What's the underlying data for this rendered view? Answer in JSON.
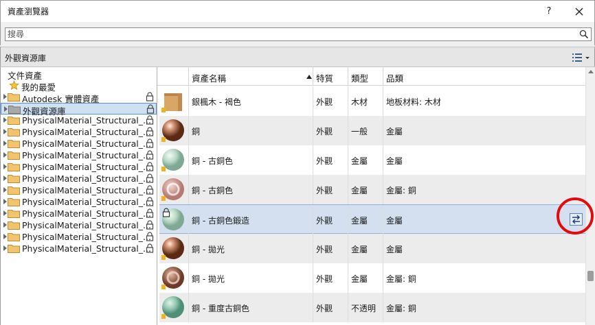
{
  "window": {
    "title": "資產瀏覽器",
    "help_label": "?"
  },
  "search": {
    "placeholder": "搜尋",
    "value": ""
  },
  "library_bar": {
    "title": "外觀資源庫"
  },
  "tree": {
    "items": [
      {
        "label": "文件資產",
        "icon": "none",
        "arrow": false,
        "lock": false
      },
      {
        "label": "我的最愛",
        "icon": "star-icon",
        "arrow": false,
        "lock": false
      },
      {
        "label": "Autodesk 實體資產",
        "icon": "folder-icon",
        "arrow": true,
        "lock": true
      },
      {
        "label": "外觀資源庫",
        "icon": "folder-gray-icon",
        "arrow": true,
        "lock": true,
        "selected": true
      },
      {
        "label": "PhysicalMaterial_Structural_...",
        "icon": "folder-icon",
        "arrow": true,
        "lock": true
      },
      {
        "label": "PhysicalMaterial_Structural_...",
        "icon": "folder-icon",
        "arrow": true,
        "lock": true
      },
      {
        "label": "PhysicalMaterial_Structural_...",
        "icon": "folder-icon",
        "arrow": true,
        "lock": true
      },
      {
        "label": "PhysicalMaterial_Structural_...",
        "icon": "folder-icon",
        "arrow": true,
        "lock": true
      },
      {
        "label": "PhysicalMaterial_Structural_...",
        "icon": "folder-icon",
        "arrow": true,
        "lock": true
      },
      {
        "label": "PhysicalMaterial_Structural_...",
        "icon": "folder-icon",
        "arrow": true,
        "lock": true
      },
      {
        "label": "PhysicalMaterial_Structural_...",
        "icon": "folder-icon",
        "arrow": true,
        "lock": true
      },
      {
        "label": "PhysicalMaterial_Structural_...",
        "icon": "folder-icon",
        "arrow": true,
        "lock": true
      },
      {
        "label": "PhysicalMaterial_Structural_...",
        "icon": "folder-icon",
        "arrow": true,
        "lock": true
      },
      {
        "label": "PhysicalMaterial_Structural_...",
        "icon": "folder-icon",
        "arrow": true,
        "lock": true
      },
      {
        "label": "PhysicalMaterial_Structural_...",
        "icon": "folder-icon",
        "arrow": true,
        "lock": true
      },
      {
        "label": "PhysicalMaterial_Structural_...",
        "icon": "folder-icon",
        "arrow": true,
        "lock": true
      }
    ]
  },
  "table": {
    "columns": [
      "資產名稱",
      "特質",
      "類型",
      "品類"
    ],
    "rows": [
      {
        "name": "銀楓木 - 褐色",
        "property": "外觀",
        "type": "木材",
        "category": "地板材料: 木材",
        "thumb": "wood"
      },
      {
        "name": "銅",
        "property": "外觀",
        "type": "一般",
        "category": "金屬",
        "thumb": "copper-sphere"
      },
      {
        "name": "銅 - 古銅色",
        "property": "外觀",
        "type": "金屬",
        "category": "金屬",
        "thumb": "patina-sphere"
      },
      {
        "name": "銅 - 古銅色",
        "property": "外觀",
        "type": "金屬",
        "category": "金屬: 銅",
        "thumb": "pink-swirl"
      },
      {
        "name": "銅 - 古銅色鍛造",
        "property": "外觀",
        "type": "金屬",
        "category": "金屬",
        "thumb": "patina-sphere",
        "selected": true
      },
      {
        "name": "銅 - 拋光",
        "property": "外觀",
        "type": "金屬",
        "category": "金屬",
        "thumb": "copper-sphere"
      },
      {
        "name": "銅 - 拋光",
        "property": "外觀",
        "type": "金屬",
        "category": "金屬: 銅",
        "thumb": "copper-swirl"
      },
      {
        "name": "銅 - 重度古銅色",
        "property": "外觀",
        "type": "不透明",
        "category": "金屬: 銅",
        "thumb": "teal-sphere"
      }
    ]
  },
  "colors": {
    "selection": "#cfe0f3",
    "highlight_circle": "#e20a0a"
  }
}
